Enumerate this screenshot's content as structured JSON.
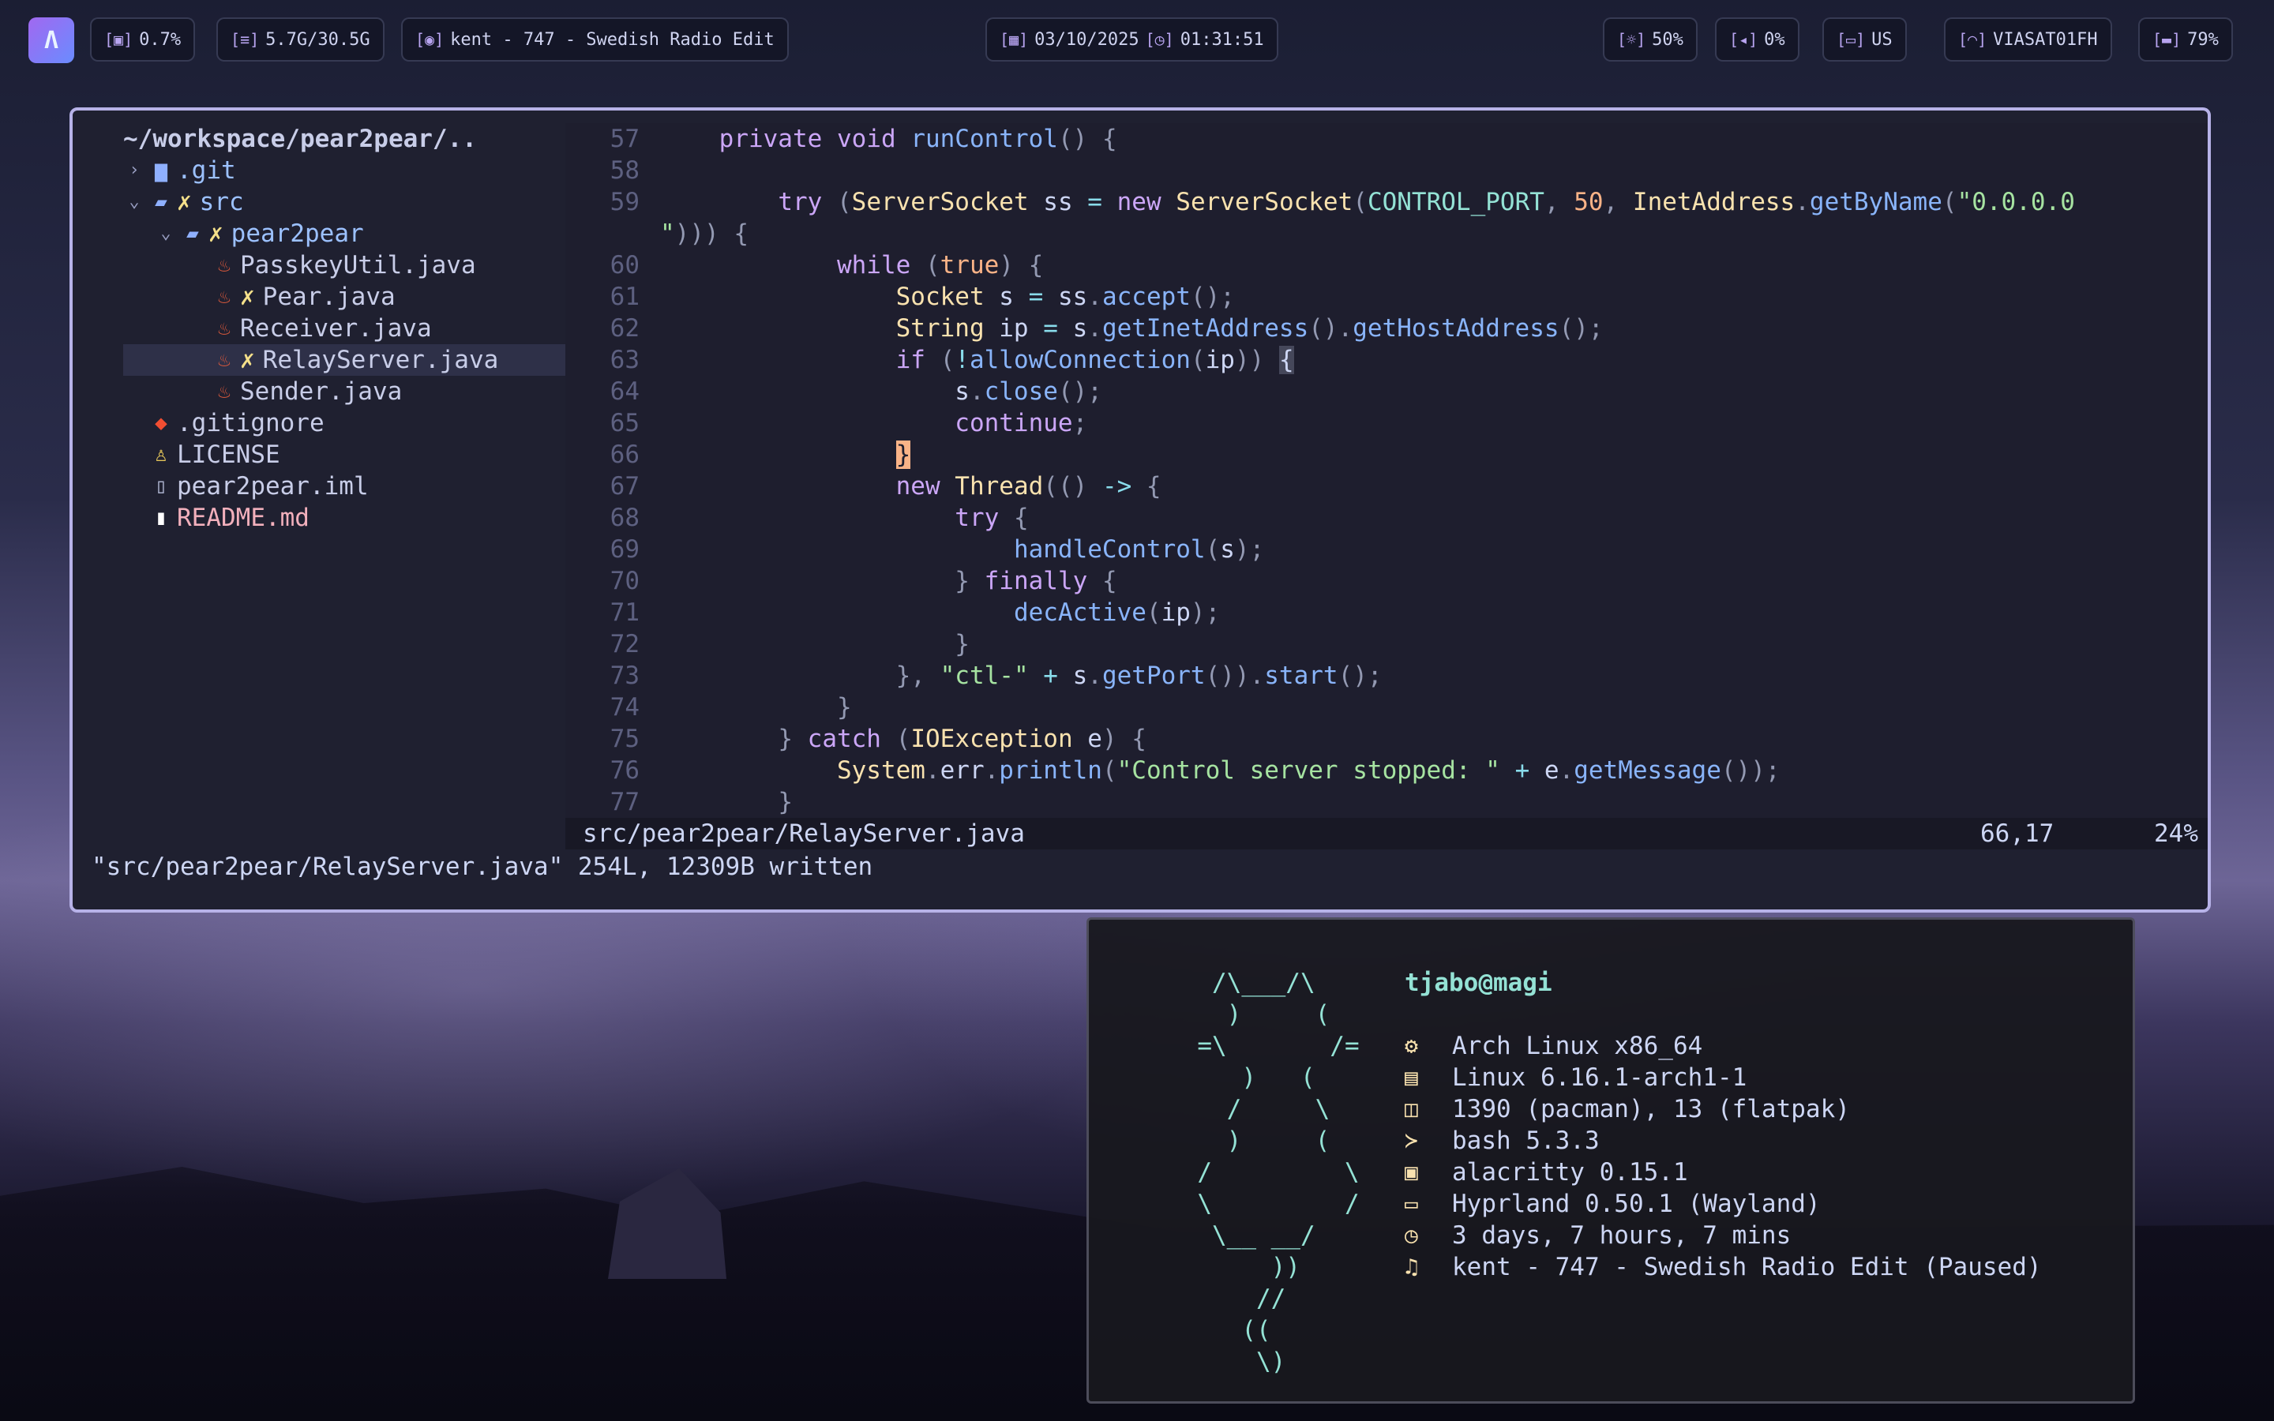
{
  "topbar": {
    "launcher_glyph": "Λ",
    "cpu": "0.7%",
    "memory": "5.7G/30.5G",
    "media": "kent - 747 - Swedish Radio Edit",
    "date": "03/10/2025",
    "time": "01:31:51",
    "brightness": "50%",
    "volume": "0%",
    "keyboard": "US",
    "wifi": "VIASAT01FH",
    "battery": "79%"
  },
  "tree": {
    "root": "~/workspace/pear2pear/..",
    "items": [
      {
        "name": ".git",
        "chev": "›",
        "icon": "folder",
        "mod": ""
      },
      {
        "name": "src",
        "chev": "⌄",
        "icon": "folder-open",
        "mod": "✗"
      },
      {
        "name": "pear2pear",
        "chev": "⌄",
        "icon": "folder-open",
        "mod": "✗"
      },
      {
        "name": "PasskeyUtil.java",
        "icon": "java",
        "mod": ""
      },
      {
        "name": "Pear.java",
        "icon": "java",
        "mod": "✗"
      },
      {
        "name": "Receiver.java",
        "icon": "java",
        "mod": ""
      },
      {
        "name": "RelayServer.java",
        "icon": "java",
        "mod": "✗"
      },
      {
        "name": "Sender.java",
        "icon": "java",
        "mod": ""
      },
      {
        "name": ".gitignore",
        "icon": "git",
        "mod": ""
      },
      {
        "name": "LICENSE",
        "icon": "license",
        "mod": ""
      },
      {
        "name": "pear2pear.iml",
        "icon": "file",
        "mod": ""
      },
      {
        "name": "README.md",
        "icon": "markdown",
        "mod": ""
      }
    ]
  },
  "code": {
    "line_numbers": [
      "57",
      "58",
      "59",
      "",
      "60",
      "61",
      "62",
      "63",
      "64",
      "65",
      "66",
      "67",
      "68",
      "69",
      "70",
      "71",
      "72",
      "73",
      "74",
      "75",
      "76",
      "77"
    ],
    "lines": [
      "    private void runControl() {",
      "",
      "        try (ServerSocket ss = new ServerSocket(CONTROL_PORT, 50, InetAddress.getByName(\"0.0.0.0",
      "\"))) {",
      "            while (true) {",
      "                Socket s = ss.accept();",
      "                String ip = s.getInetAddress().getHostAddress();",
      "                if (!allowConnection(ip)) {",
      "                    s.close();",
      "                    continue;",
      "                }",
      "                new Thread(() -> {",
      "                    try {",
      "                        handleControl(s);",
      "                    } finally {",
      "                        decActive(ip);",
      "                    }",
      "                }, \"ctl-\" + s.getPort()).start();",
      "            }",
      "        } catch (IOException e) {",
      "            System.err.println(\"Control server stopped: \" + e.getMessage());",
      "        }"
    ]
  },
  "status": {
    "file": "src/pear2pear/RelayServer.java",
    "position": "66,17",
    "percent": "24%"
  },
  "cmdline": "\"src/pear2pear/RelayServer.java\" 254L, 12309B written",
  "fetch": {
    "ascii": "   /\\___/\\\n    )     (\n  =\\       /=\n     )   (\n    /     \\\n    )     (\n  /         \\\n  \\         /\n   \\__ __/\n       ))\n      //\n     ((\n      \\)",
    "userhost": "tjabo@magi",
    "rows": [
      {
        "icon": "gear-icon",
        "glyph": "⚙",
        "text": "Arch Linux x86_64"
      },
      {
        "icon": "server-icon",
        "glyph": "▤",
        "text": "Linux 6.16.1-arch1-1"
      },
      {
        "icon": "package-icon",
        "glyph": "◫",
        "text": "1390 (pacman), 13 (flatpak)"
      },
      {
        "icon": "shell-icon",
        "glyph": "≻",
        "text": "bash 5.3.3"
      },
      {
        "icon": "terminal-icon",
        "glyph": "▣",
        "text": "alacritty 0.15.1"
      },
      {
        "icon": "window-icon",
        "glyph": "▭",
        "text": "Hyprland 0.50.1 (Wayland)"
      },
      {
        "icon": "clock-icon",
        "glyph": "◷",
        "text": "3 days, 7 hours, 7 mins"
      },
      {
        "icon": "music-icon",
        "glyph": "♫",
        "text": "kent - 747 - Swedish Radio Edit (Paused)"
      }
    ]
  }
}
